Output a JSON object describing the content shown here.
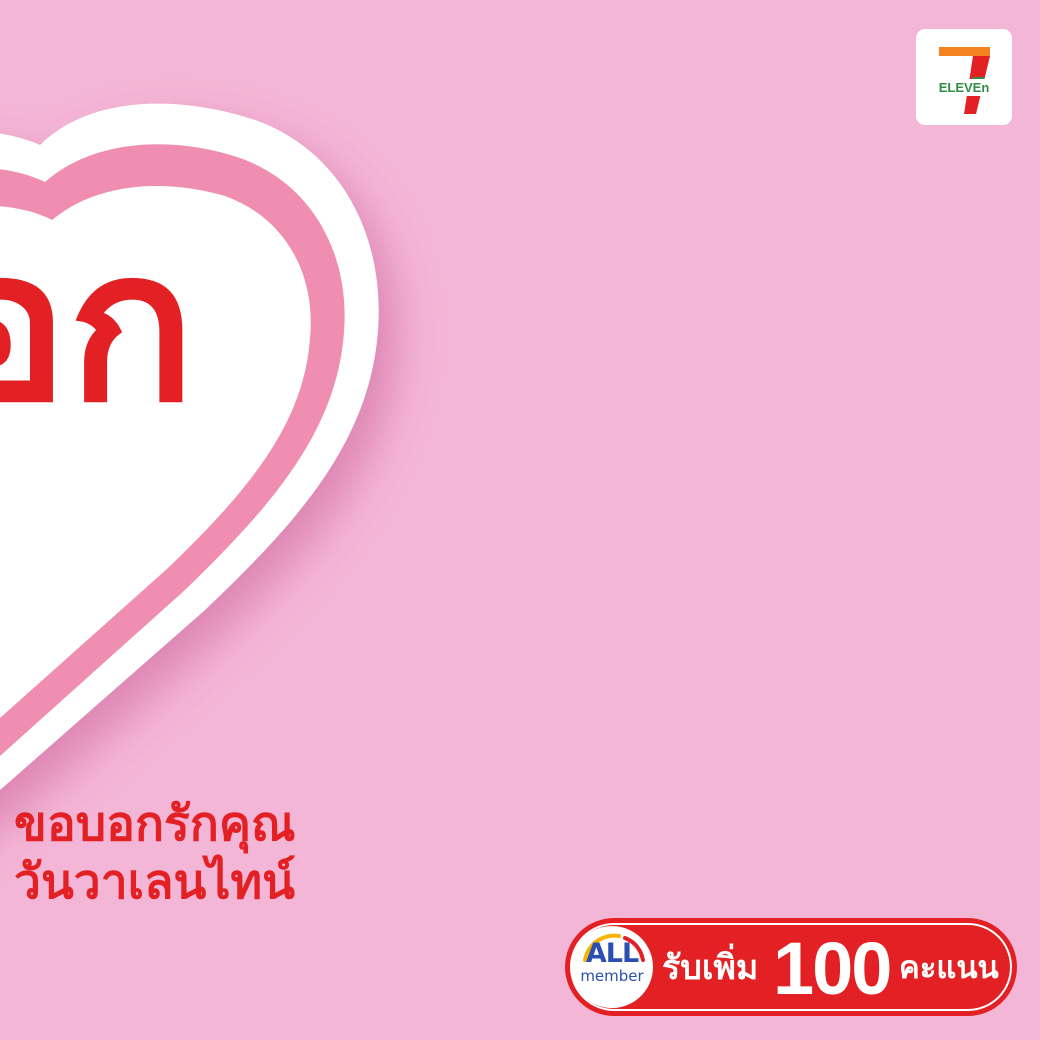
{
  "colors": {
    "background": "#f4b6d6",
    "brand_red": "#e32024",
    "heart_outline": "#ef8eb0",
    "white": "#ffffff"
  },
  "hero": {
    "line1": "อก",
    "line2": "ก"
  },
  "logo": {
    "name": "7-eleven-logo",
    "text": "ELEVEn"
  },
  "tagline": {
    "line1": "ขอบอกรักคุณ",
    "line2": "วันวาเลนไทน์"
  },
  "reward": {
    "badge_all": "ALL",
    "badge_member": "member",
    "label": "รับเพิ่ม",
    "points": "100",
    "unit": "คะแนน"
  }
}
